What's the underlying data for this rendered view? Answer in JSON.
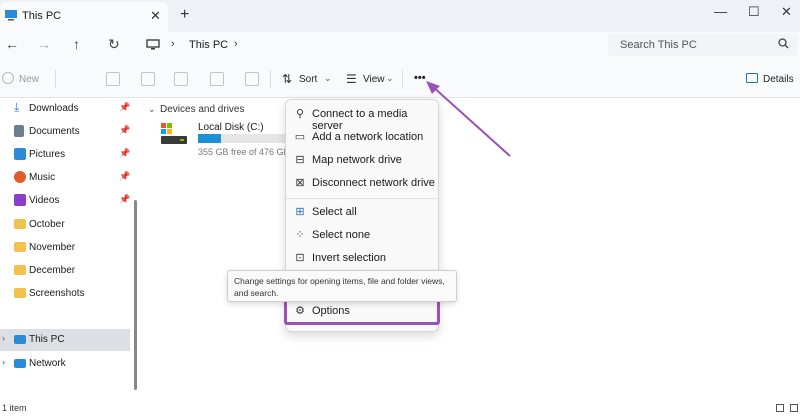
{
  "tab": {
    "title": "This PC",
    "close": "✕",
    "new": "+"
  },
  "window": {
    "minimize": "—",
    "maximize": "☐",
    "close": "✕"
  },
  "nav": {
    "back": "←",
    "forward": "→",
    "up": "↑",
    "refresh": "↻",
    "breadcrumb": "This PC",
    "chevron": "›",
    "search_placeholder": "Search This PC"
  },
  "toolbar": {
    "new_label": "New",
    "sort_label": "Sort",
    "view_label": "View",
    "more_label": "•••",
    "details_label": "Details"
  },
  "sidebar": {
    "pinned": [
      {
        "label": "Downloads",
        "color": "#2f7fd0"
      },
      {
        "label": "Documents",
        "color": "#6b7c93"
      },
      {
        "label": "Pictures",
        "color": "#2a8bd6"
      },
      {
        "label": "Music",
        "color": "#e25b2a"
      },
      {
        "label": "Videos",
        "color": "#8b3fc9"
      }
    ],
    "folders": [
      "October",
      "November",
      "December",
      "Screenshots"
    ],
    "this_pc": "This PC",
    "network": "Network"
  },
  "content": {
    "group_heading": "Devices and drives",
    "drive_name": "Local Disk (C:)",
    "drive_free": "355 GB free of 476 GB",
    "drive_used_fraction": 0.25
  },
  "menu": {
    "items": [
      {
        "label": "Connect to a media server",
        "icon": "media-server-icon"
      },
      {
        "label": "Add a network location",
        "icon": "network-location-icon"
      },
      {
        "label": "Map network drive",
        "icon": "map-drive-icon"
      },
      {
        "label": "Disconnect network drive",
        "icon": "disconnect-drive-icon"
      },
      {
        "label": "Select all",
        "icon": "select-all-icon"
      },
      {
        "label": "Select none",
        "icon": "select-none-icon"
      },
      {
        "label": "Invert selection",
        "icon": "invert-selection-icon"
      },
      {
        "label": "Options",
        "icon": "gear-icon"
      }
    ]
  },
  "tooltip": "Change settings for opening items, file and folder views, and search.",
  "status": {
    "count": "1 item"
  },
  "colors": {
    "accent": "#9b52b8",
    "drive_fill": "#1e91d6"
  }
}
